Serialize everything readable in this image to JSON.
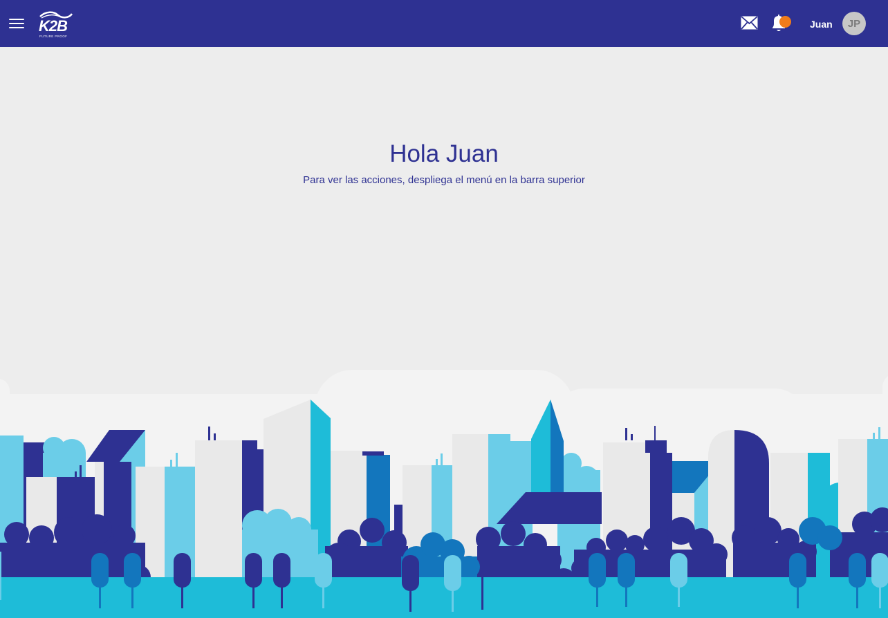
{
  "header": {
    "logo": {
      "name": "K2B",
      "tagline": "FUTURE PROOF"
    },
    "menu_icon": "hamburger-icon",
    "mail_icon": "mail-icon",
    "bell_icon": "bell-icon",
    "notification_color": "#f07c1a",
    "user_name": "Juan",
    "avatar_initials": "JP"
  },
  "main": {
    "title": "Hola Juan",
    "subtitle": "Para ver las acciones, despliega el menú en la barra superior"
  },
  "colors": {
    "brand": "#2e3192",
    "background": "#ededed",
    "accent_cyan": "#1ebcd8",
    "accent_light_blue": "#6bcde8",
    "accent_mid_blue": "#1376bd"
  }
}
